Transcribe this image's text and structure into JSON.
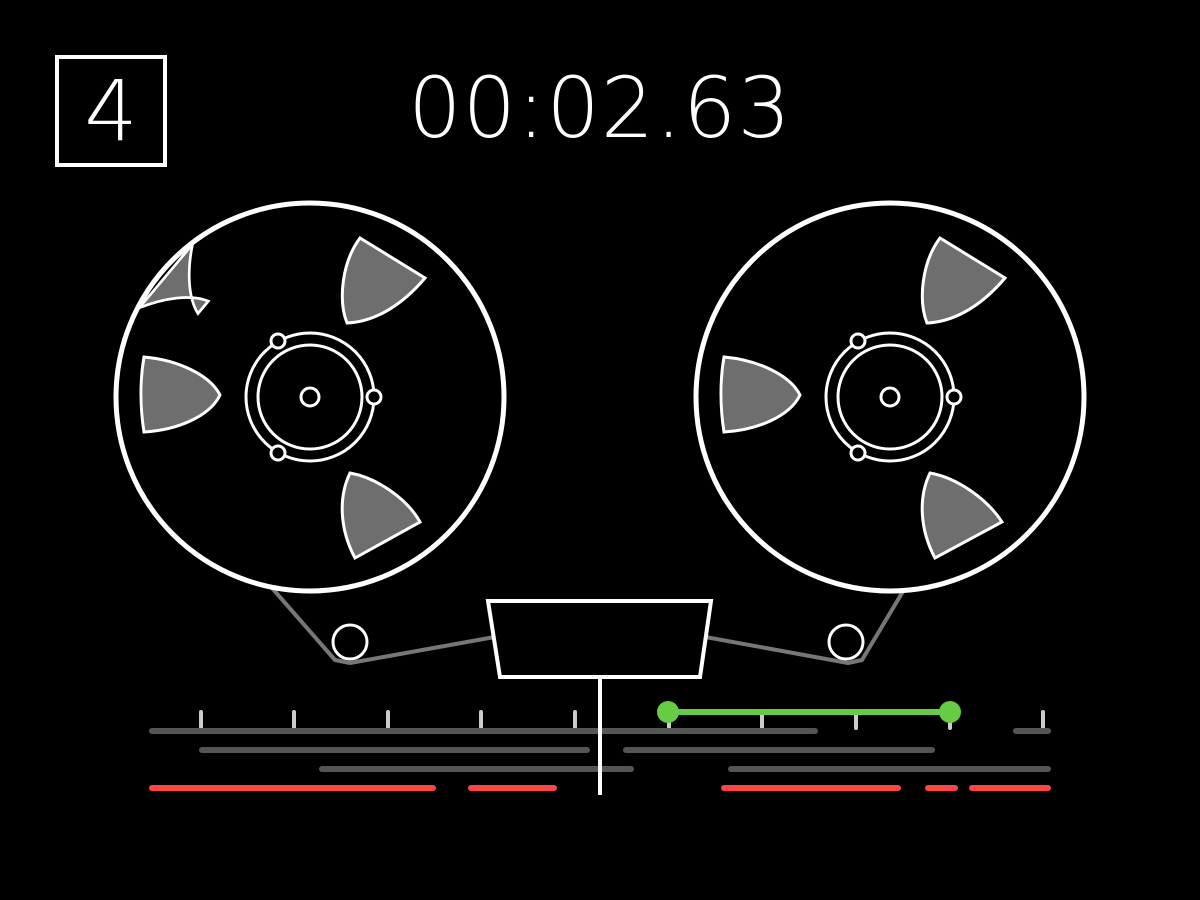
{
  "track": {
    "number": "4"
  },
  "timecode": "00:02.63",
  "colors": {
    "background": "#000000",
    "foreground": "#ffffff",
    "spoke_fill": "#707070",
    "tape": "#777777",
    "lane": "#555555",
    "loop_region": "#66cc44",
    "clip": "#ff4444"
  },
  "icons": {
    "left_reel": "tape-reel-icon",
    "right_reel": "tape-reel-icon",
    "tape_head": "tape-head-icon",
    "playhead": "playhead-icon"
  }
}
